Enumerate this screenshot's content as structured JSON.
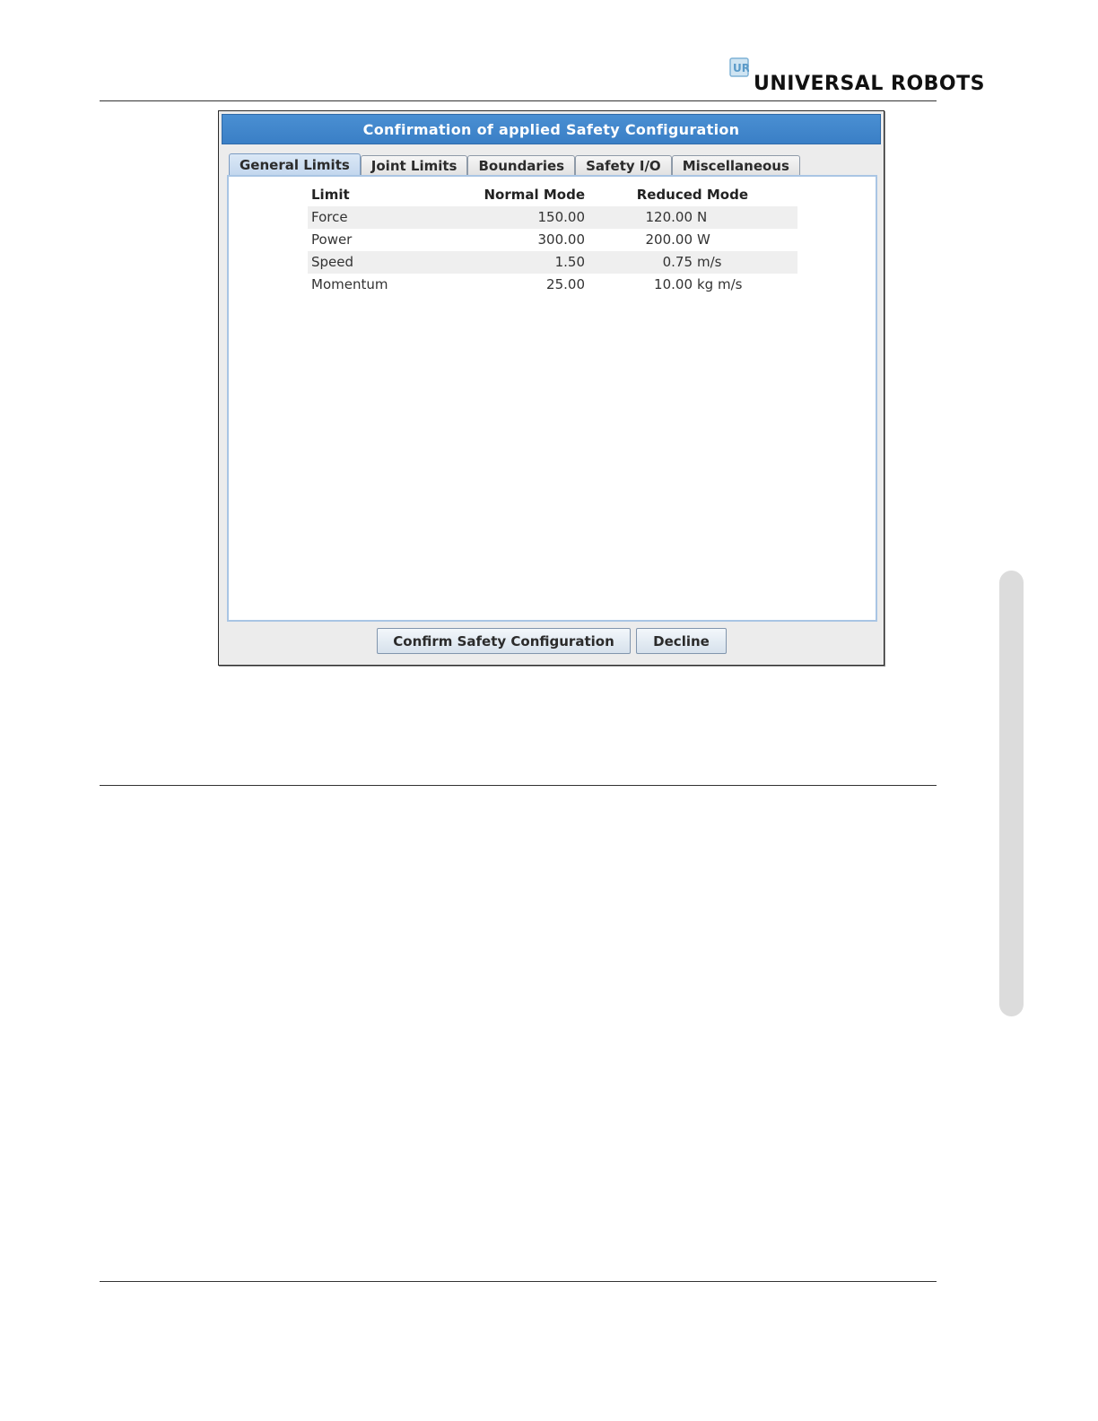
{
  "header": {
    "brand": "UNIVERSAL ROBOTS",
    "logo_mark": "UR"
  },
  "dialog": {
    "title": "Confirmation of applied Safety Configuration",
    "tabs": [
      {
        "label": "General Limits",
        "active": true
      },
      {
        "label": "Joint Limits",
        "active": false
      },
      {
        "label": "Boundaries",
        "active": false
      },
      {
        "label": "Safety I/O",
        "active": false
      },
      {
        "label": "Miscellaneous",
        "active": false
      }
    ],
    "table": {
      "headers": {
        "limit": "Limit",
        "normal": "Normal Mode",
        "reduced": "Reduced Mode"
      },
      "rows": [
        {
          "limit": "Force",
          "normal": "150.00",
          "reduced": "120.00",
          "unit": "N"
        },
        {
          "limit": "Power",
          "normal": "300.00",
          "reduced": "200.00",
          "unit": "W"
        },
        {
          "limit": "Speed",
          "normal": "1.50",
          "reduced": "0.75",
          "unit": "m/s"
        },
        {
          "limit": "Momentum",
          "normal": "25.00",
          "reduced": "10.00",
          "unit": "kg m/s"
        }
      ]
    },
    "buttons": {
      "confirm": "Confirm Safety Configuration",
      "decline": "Decline"
    }
  },
  "colors": {
    "titlebar": "#3a7fc6",
    "active_tab": "#c3d7ee",
    "panel_border": "#a9c5e4",
    "row_alt": "#efefef"
  }
}
